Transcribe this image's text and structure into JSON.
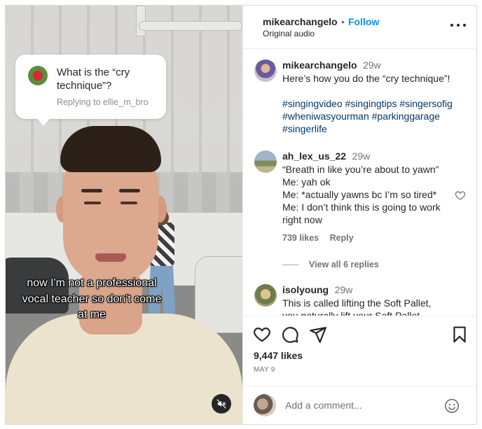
{
  "video": {
    "reply_sticker": {
      "question": "What is the “cry technique”?",
      "replying_to": "Replying to ellie_m_bro"
    },
    "caption": "now I'm not a professional vocal teacher so don't come at me",
    "mute_icon": "speaker-muted-icon"
  },
  "header": {
    "username": "mikearchangelo",
    "separator": "•",
    "follow_label": "Follow",
    "audio": "Original audio",
    "more_icon": "more-horizontal-icon"
  },
  "post_caption": {
    "username": "mikearchangelo",
    "time": "29w",
    "text": "Here’s how you do the “cry technique”!",
    "hashtags_line1": "#singingvideo #singingtips #singersofig",
    "hashtags_line2": "#wheniwasyourman #parkinggarage",
    "hashtags_line3": "#singerlife"
  },
  "comments": [
    {
      "username": "ah_lex_us_22",
      "time": "29w",
      "text": "“Breath in like you’re about to yawn”\nMe: yah ok\nMe: *actually yawns bc I’m so tired*\nMe: I don’t think this is going to work\nright now",
      "likes": "739 likes",
      "reply_label": "Reply",
      "view_replies": "View all 6 replies"
    },
    {
      "username": "isolyoung",
      "time": "29w",
      "text": "This is called lifting the Soft Pallet,\nyou naturally lift your Soft Pallet"
    }
  ],
  "actions": {
    "like_icon": "heart-icon",
    "comment_icon": "comment-icon",
    "share_icon": "paper-plane-icon",
    "save_icon": "bookmark-icon",
    "likes": "9,447 likes",
    "date": "MAY 9"
  },
  "add_comment": {
    "placeholder": "Add a comment...",
    "emoji_icon": "smiley-icon"
  }
}
